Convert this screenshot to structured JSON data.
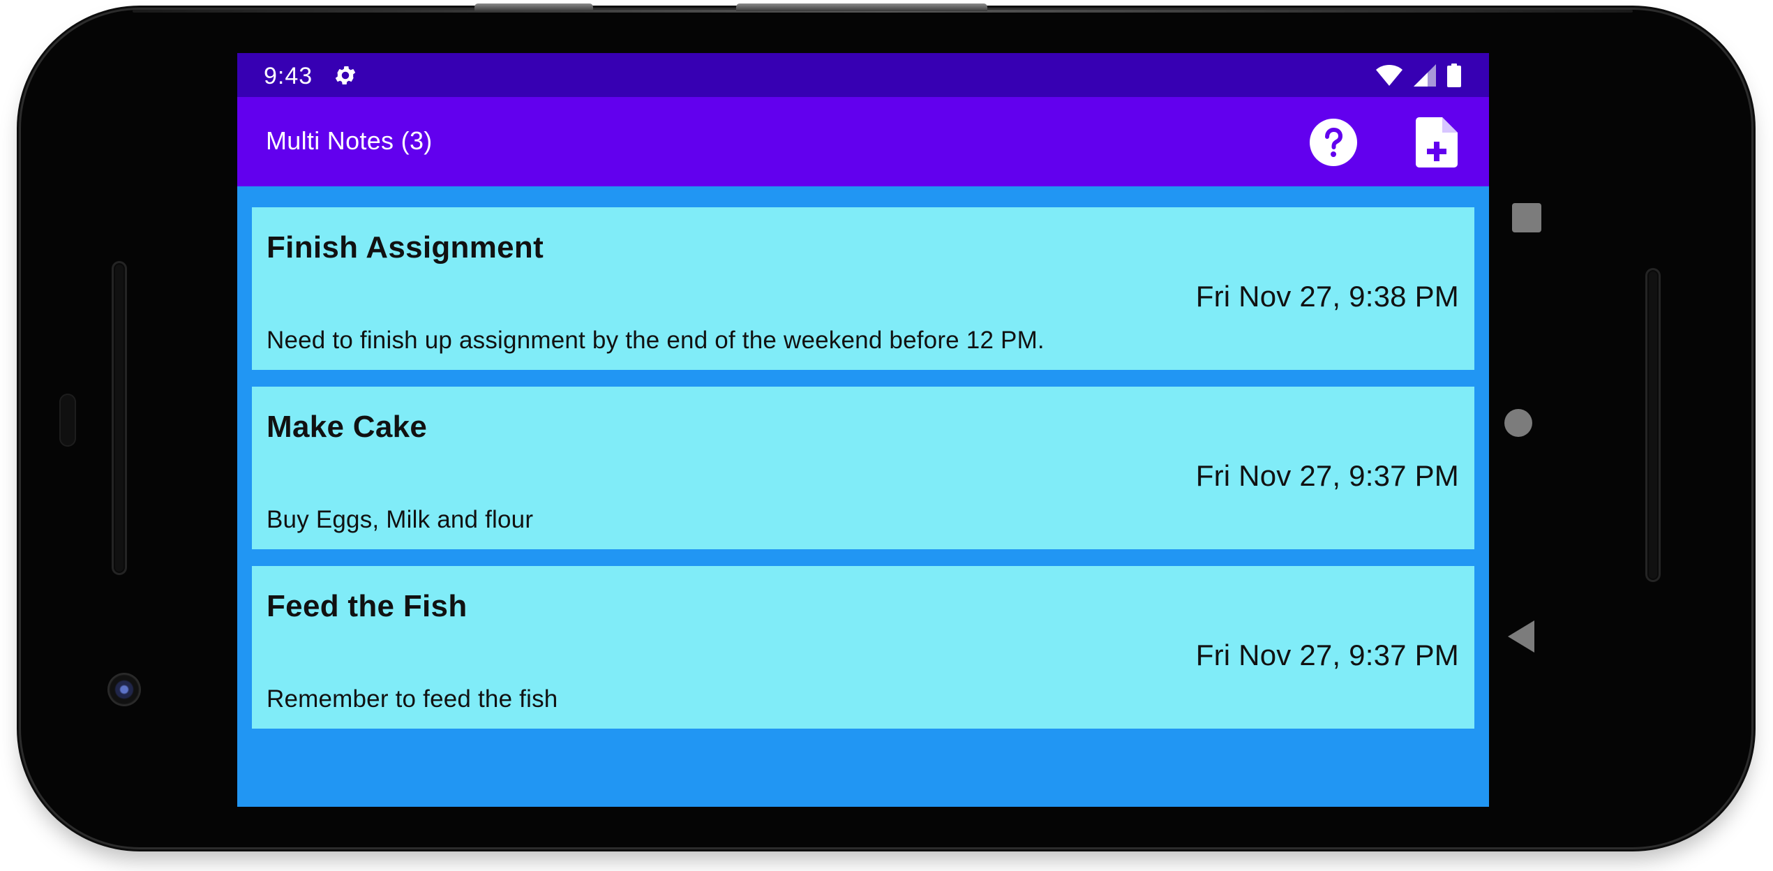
{
  "status_bar": {
    "time": "9:43",
    "icons": [
      "gear-icon",
      "wifi-icon",
      "cell-signal-icon",
      "battery-icon"
    ]
  },
  "app_bar": {
    "title": "Multi Notes (3)",
    "actions": [
      {
        "name": "help-icon",
        "label": "?"
      },
      {
        "name": "new-note-icon",
        "label": "+"
      }
    ]
  },
  "notes": [
    {
      "title": "Finish Assignment",
      "date": "Fri Nov 27, 9:38 PM",
      "body": "Need to finish up assignment by the end of the weekend before 12 PM."
    },
    {
      "title": "Make Cake",
      "date": "Fri Nov 27, 9:37 PM",
      "body": "Buy Eggs, Milk and flour"
    },
    {
      "title": "Feed the Fish",
      "date": "Fri Nov 27, 9:37 PM",
      "body": "Remember to feed the fish"
    }
  ],
  "colors": {
    "status_bar": "#3700b3",
    "app_bar": "#6200ee",
    "list_background": "#2196f3",
    "card_background": "#80ecf8"
  },
  "navigation": [
    "recents-button",
    "home-button",
    "back-button"
  ]
}
